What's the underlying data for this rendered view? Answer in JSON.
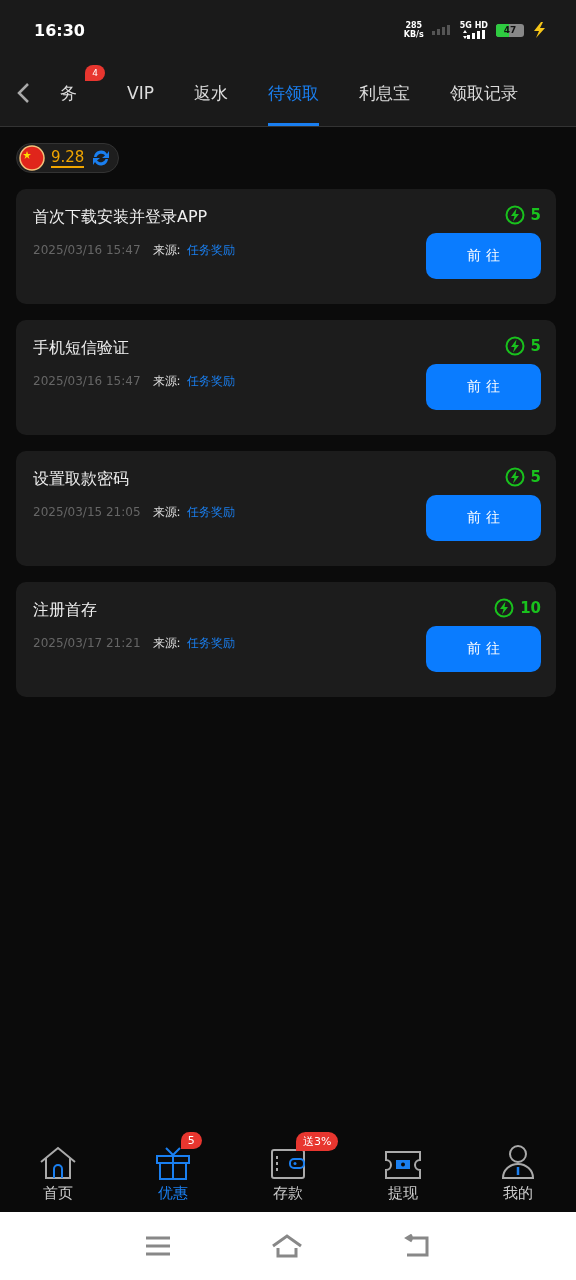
{
  "status_bar": {
    "time": "16:30",
    "speed": "285",
    "speed_unit": "KB/s",
    "network": "5G HD",
    "battery": "47"
  },
  "tabs": [
    {
      "label": "务",
      "badge": "4",
      "selected": false
    },
    {
      "label": "VIP",
      "selected": false
    },
    {
      "label": "返水",
      "selected": false
    },
    {
      "label": "待领取",
      "selected": true
    },
    {
      "label": "利息宝",
      "selected": false
    },
    {
      "label": "领取记录",
      "selected": false
    }
  ],
  "balance": {
    "amount": "9.28"
  },
  "tasks": [
    {
      "title": "首次下载安装并登录APP",
      "time": "2025/03/16 15:47",
      "source_label": "来源:",
      "source": "任务奖励",
      "reward": "5",
      "button": "前 往"
    },
    {
      "title": "手机短信验证",
      "time": "2025/03/16 15:47",
      "source_label": "来源:",
      "source": "任务奖励",
      "reward": "5",
      "button": "前 往"
    },
    {
      "title": "设置取款密码",
      "time": "2025/03/15 21:05",
      "source_label": "来源:",
      "source": "任务奖励",
      "reward": "5",
      "button": "前 往"
    },
    {
      "title": "注册首存",
      "time": "2025/03/17 21:21",
      "source_label": "来源:",
      "source": "任务奖励",
      "reward": "10",
      "button": "前 往"
    }
  ],
  "bottom_nav": [
    {
      "kind": "home",
      "label": "首页",
      "selected": false
    },
    {
      "kind": "gift",
      "label": "优惠",
      "badge": "5",
      "selected": true
    },
    {
      "kind": "wallet",
      "label": "存款",
      "badge": "送3%",
      "selected": false
    },
    {
      "kind": "ticket",
      "label": "提现",
      "selected": false
    },
    {
      "kind": "user",
      "label": "我的",
      "selected": false
    }
  ]
}
